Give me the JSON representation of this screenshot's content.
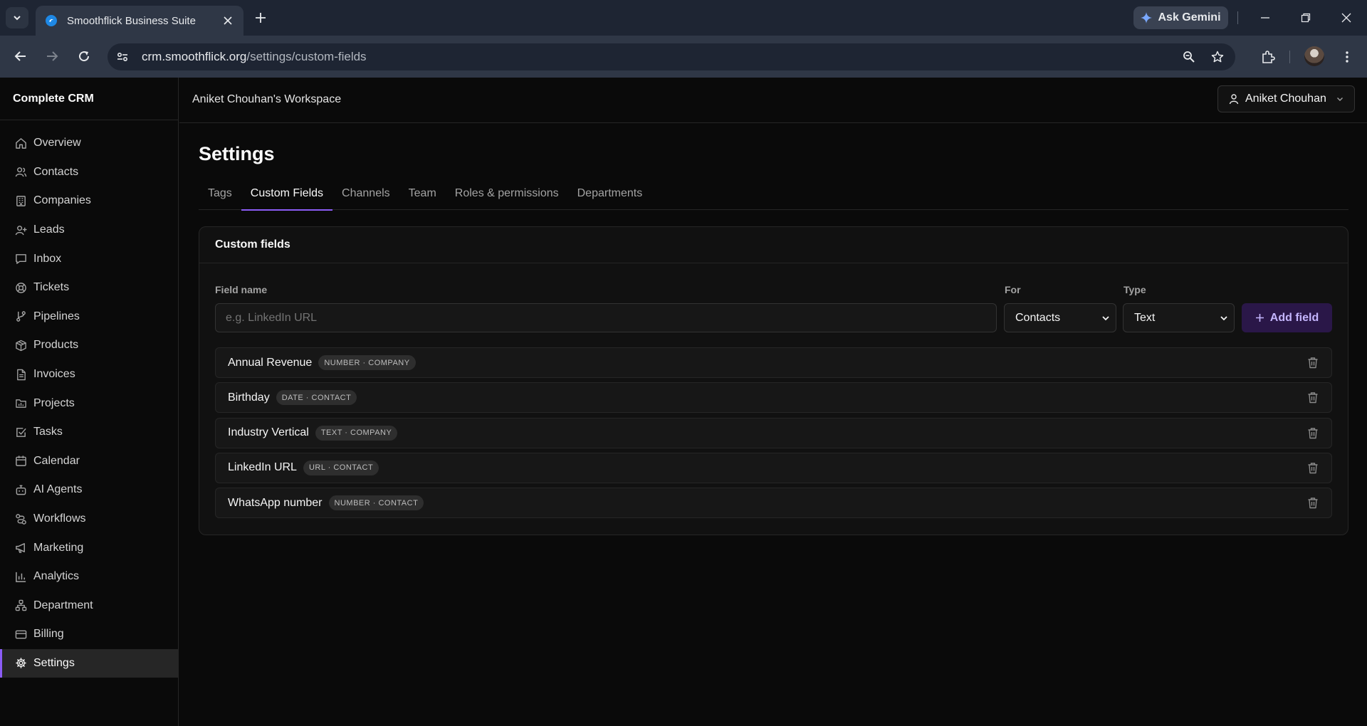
{
  "browser": {
    "tab_title": "Smoothflick Business Suite",
    "gemini_label": "Ask Gemini",
    "url_host": "crm.smoothflick.org",
    "url_path": "/settings/custom-fields"
  },
  "sidebar": {
    "brand": "Complete CRM",
    "items": [
      {
        "label": "Overview",
        "icon": "home-icon"
      },
      {
        "label": "Contacts",
        "icon": "users-icon"
      },
      {
        "label": "Companies",
        "icon": "building-icon"
      },
      {
        "label": "Leads",
        "icon": "user-plus-icon"
      },
      {
        "label": "Inbox",
        "icon": "message-icon"
      },
      {
        "label": "Tickets",
        "icon": "lifebuoy-icon"
      },
      {
        "label": "Pipelines",
        "icon": "git-branch-icon"
      },
      {
        "label": "Products",
        "icon": "package-icon"
      },
      {
        "label": "Invoices",
        "icon": "file-text-icon"
      },
      {
        "label": "Projects",
        "icon": "folder-chart-icon"
      },
      {
        "label": "Tasks",
        "icon": "check-square-icon"
      },
      {
        "label": "Calendar",
        "icon": "calendar-icon"
      },
      {
        "label": "AI Agents",
        "icon": "bot-icon"
      },
      {
        "label": "Workflows",
        "icon": "workflow-icon"
      },
      {
        "label": "Marketing",
        "icon": "megaphone-icon"
      },
      {
        "label": "Analytics",
        "icon": "bar-chart-icon"
      },
      {
        "label": "Department",
        "icon": "network-icon"
      },
      {
        "label": "Billing",
        "icon": "credit-card-icon"
      },
      {
        "label": "Settings",
        "icon": "gear-icon",
        "active": true
      }
    ]
  },
  "header": {
    "workspace": "Aniket Chouhan's Workspace",
    "user_name": "Aniket Chouhan"
  },
  "page": {
    "title": "Settings",
    "tabs": [
      {
        "label": "Tags"
      },
      {
        "label": "Custom Fields",
        "active": true
      },
      {
        "label": "Channels"
      },
      {
        "label": "Team"
      },
      {
        "label": "Roles & permissions"
      },
      {
        "label": "Departments"
      }
    ]
  },
  "custom_fields": {
    "card_title": "Custom fields",
    "form": {
      "field_name_label": "Field name",
      "field_name_placeholder": "e.g. LinkedIn URL",
      "field_name_value": "",
      "for_label": "For",
      "for_value": "Contacts",
      "type_label": "Type",
      "type_value": "Text",
      "add_button": "Add field"
    },
    "rows": [
      {
        "name": "Annual Revenue",
        "badge": "NUMBER · COMPANY"
      },
      {
        "name": "Birthday",
        "badge": "DATE · CONTACT"
      },
      {
        "name": "Industry Vertical",
        "badge": "TEXT · COMPANY"
      },
      {
        "name": "LinkedIn URL",
        "badge": "URL · CONTACT"
      },
      {
        "name": "WhatsApp number",
        "badge": "NUMBER · CONTACT"
      }
    ]
  },
  "colors": {
    "accent": "#8b5cf6",
    "add_button_bg": "#2a1748",
    "background": "#0a0a0a",
    "card": "#111111"
  }
}
